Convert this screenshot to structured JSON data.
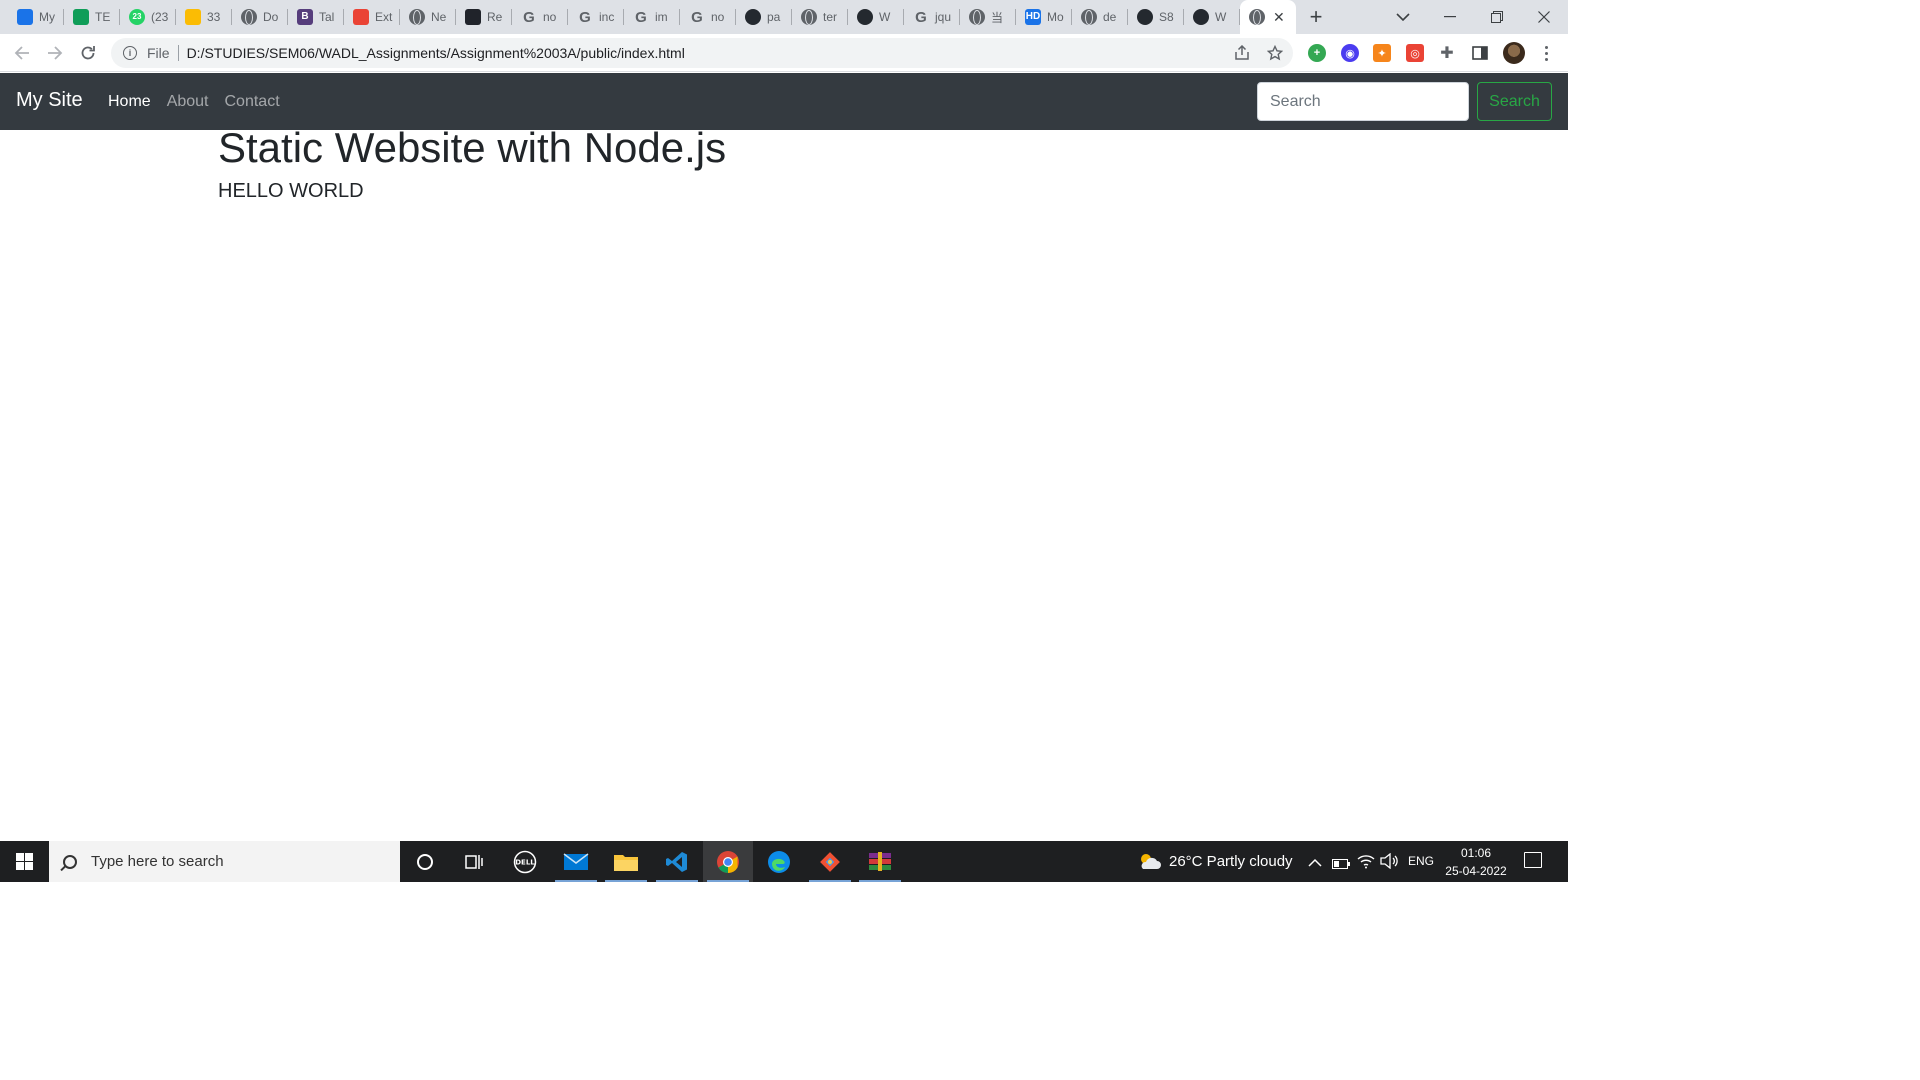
{
  "browser": {
    "tabs": [
      {
        "title": "My",
        "icon": "google-drive-icon",
        "color": "#1a73e8"
      },
      {
        "title": "TE",
        "icon": "google-sheets-icon",
        "color": "#0f9d58"
      },
      {
        "title": "(23",
        "icon": "whatsapp-badge-icon",
        "color": "#25d366",
        "badge": "23"
      },
      {
        "title": "33",
        "icon": "google-drive-icon",
        "color": "#fbbc04"
      },
      {
        "title": "Do",
        "icon": "globe-icon"
      },
      {
        "title": "Tal",
        "icon": "bootstrap-icon",
        "color": "#563d7c",
        "glyph": "B"
      },
      {
        "title": "Ext",
        "icon": "target-icon",
        "color": "#ea4335"
      },
      {
        "title": "Ne",
        "icon": "chrome-icon",
        "color": "#5f6368"
      },
      {
        "title": "Re",
        "icon": "react-icon",
        "color": "#20232a"
      },
      {
        "title": "no",
        "icon": "google-icon"
      },
      {
        "title": "inc",
        "icon": "google-icon"
      },
      {
        "title": "im",
        "icon": "google-icon"
      },
      {
        "title": "no",
        "icon": "google-icon"
      },
      {
        "title": "pa",
        "icon": "github-icon"
      },
      {
        "title": "ter",
        "icon": "globe-icon"
      },
      {
        "title": "W",
        "icon": "github-icon"
      },
      {
        "title": "jqu",
        "icon": "google-icon"
      },
      {
        "title": "当",
        "icon": "globe-icon"
      },
      {
        "title": "Mo",
        "icon": "hd-icon",
        "color": "#1a73e8",
        "glyph": "HD"
      },
      {
        "title": "de",
        "icon": "globe-icon"
      },
      {
        "title": "S8",
        "icon": "github-icon"
      },
      {
        "title": "W",
        "icon": "github-icon"
      }
    ],
    "active_tab_icon": "globe-icon",
    "new_tab_label": "+",
    "address": {
      "scheme": "File",
      "url": "D:/STUDIES/SEM06/WADL_Assignments/Assignment%2003A/public/index.html"
    }
  },
  "page": {
    "navbar": {
      "brand": "My Site",
      "links": [
        {
          "label": "Home",
          "active": true
        },
        {
          "label": "About",
          "active": false
        },
        {
          "label": "Contact",
          "active": false
        }
      ],
      "search_placeholder": "Search",
      "search_button": "Search"
    },
    "title": "Static Website with Node.js",
    "lead": "HELLO WORLD"
  },
  "taskbar": {
    "search_placeholder": "Type here to search",
    "weather": "26°C  Partly cloudy",
    "language": "ENG",
    "time": "01:06",
    "date": "25-04-2022"
  },
  "colors": {
    "navbar_bg": "#343a40",
    "success_green": "#28a745",
    "tabstrip_bg": "#dee1e6"
  }
}
